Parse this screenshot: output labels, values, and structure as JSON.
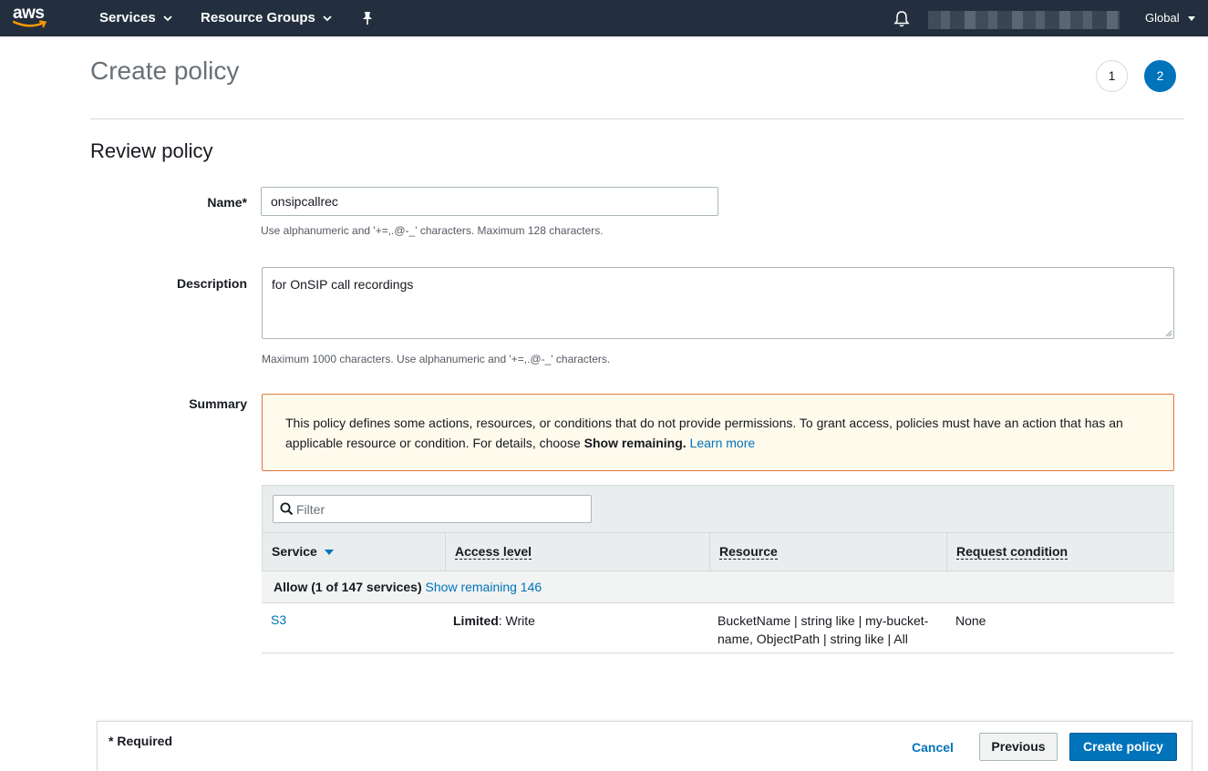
{
  "nav": {
    "logo_text": "aws",
    "services_label": "Services",
    "resource_groups_label": "Resource Groups",
    "region_label": "Global"
  },
  "page": {
    "title": "Create policy",
    "steps": [
      "1",
      "2"
    ],
    "active_step": "2"
  },
  "review": {
    "section_title": "Review policy",
    "name_label": "Name*",
    "name_value": "onsipcallrec",
    "name_hint": "Use alphanumeric and '+=,.@-_' characters. Maximum 128 characters.",
    "description_label": "Description",
    "description_value": "for OnSIP call recordings",
    "description_hint": "Maximum 1000 characters. Use alphanumeric and '+=,.@-_' characters.",
    "summary_label": "Summary"
  },
  "alert": {
    "text_1": "This policy defines some actions, resources, or conditions that do not provide permissions. To grant access, policies must have an action that has an applicable resource or condition. For details, choose ",
    "bold": "Show remaining.",
    "link": "Learn more"
  },
  "table": {
    "filter_placeholder": "Filter",
    "columns": [
      "Service",
      "Access level",
      "Resource",
      "Request condition"
    ],
    "group_label": "Allow (1 of 147 services)",
    "group_link": "Show remaining 146",
    "rows": [
      {
        "service": "S3",
        "access_bold": "Limited",
        "access_rest": ": Write",
        "resource_line1": "BucketName | string like | my-bucket-",
        "resource_line2": "name, ObjectPath | string like | All",
        "condition": "None"
      }
    ]
  },
  "footer": {
    "required_label": "* Required",
    "cancel_label": "Cancel",
    "previous_label": "Previous",
    "create_label": "Create policy"
  },
  "colors": {
    "nav_bg": "#232f3e",
    "primary": "#0073bb",
    "alert_border": "#e07941",
    "alert_bg": "#fefaec"
  }
}
